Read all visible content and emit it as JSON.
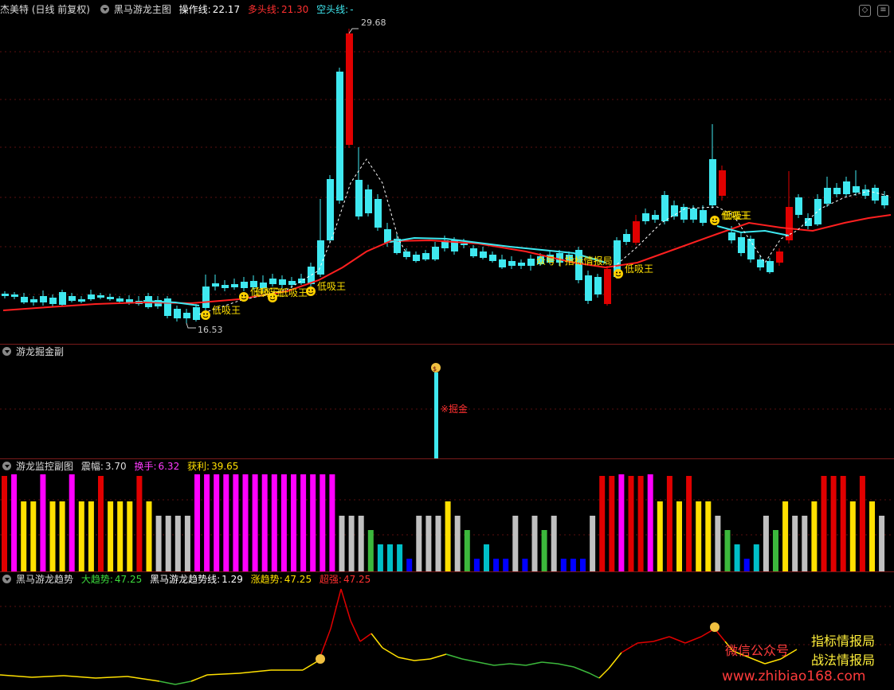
{
  "main": {
    "stock": "杰美特 (日线 前复权)",
    "indicator": "黑马游龙主图",
    "op_label": "操作线:",
    "op_value": "22.17",
    "bull_label": "多头线:",
    "bull_value": "21.30",
    "bear_label": "空头线:",
    "bear_value": "-",
    "high_label": "29.68",
    "low_label": "16.53",
    "signal_text": "低吸王",
    "overlay_text": "众号 | 指标情报局",
    "colors": {
      "up": "#e00000",
      "down": "#3fe8f0",
      "ma_red": "#ff2020",
      "ma_cyan": "#3fe8f0",
      "signal": "#ffe000"
    }
  },
  "panel2": {
    "title": "游龙掘金副",
    "signal": "※掘金"
  },
  "panel3": {
    "title": "游龙监控副图",
    "amp_label": "震幅:",
    "amp_value": "3.70",
    "turn_label": "换手:",
    "turn_value": "6.32",
    "profit_label": "获利:",
    "profit_value": "39.65"
  },
  "panel4": {
    "title": "黑马游龙趋势",
    "big_label": "大趋势:",
    "big_value": "47.25",
    "line_label": "黑马游龙趋势线:",
    "line_value": "1.29",
    "rise_label": "涨趋势:",
    "rise_value": "47.25",
    "strong_label": "超强:",
    "strong_value": "47.25"
  },
  "watermark": {
    "wechat": "微信公众号",
    "line1": "指标情报局",
    "line2": "战法情报局",
    "url": "www.zhibiao168.com"
  },
  "icons": [
    "diamond-icon",
    "menu-icon",
    "collapse-icon",
    "money-bag-icon",
    "smiley-icon"
  ]
}
